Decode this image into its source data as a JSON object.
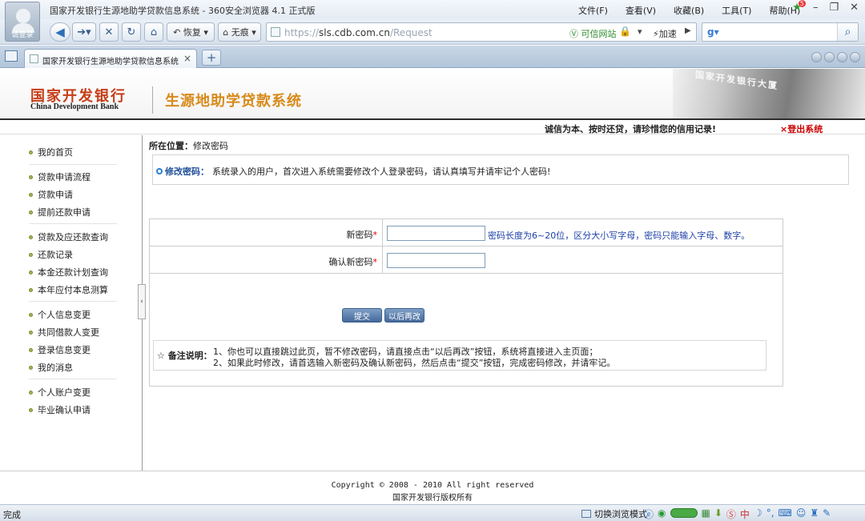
{
  "browser": {
    "avatar_label": "请登录",
    "window_title": "国家开发银行生源地助学贷款信息系统 - 360安全浏览器 4.1 正式版",
    "menu": [
      "文件(F)",
      "查看(V)",
      "收藏(B)",
      "工具(T)",
      "帮助(H)"
    ],
    "notification_count": "5",
    "restore_label": "恢复",
    "noimage_label": "无痕",
    "url_scheme": "https://",
    "url_host": "sls.cdb.com.cn",
    "url_path": "/Request",
    "trust_label": "可信网站",
    "speed_label": "加速",
    "tab_title": "国家开发银行生源地助学贷款信息系统",
    "status_text": "完成",
    "mode_label": "切换浏览模式"
  },
  "header": {
    "bank_name_cn": "国家开发银行",
    "bank_name_en": "China Development Bank",
    "system_title": "生源地助学贷款系统",
    "building_sign": "国家开发银行大厦",
    "slogan": "诚信为本、按时还贷，请珍惜您的信用记录!",
    "logout": "×登出系统"
  },
  "sidebar": {
    "items": [
      "我的首页",
      "贷款申请流程",
      "贷款申请",
      "提前还款申请",
      "贷款及应还款查询",
      "还款记录",
      "本金还款计划查询",
      "本年应付本息测算",
      "个人信息变更",
      "共同借款人变更",
      "登录信息变更",
      "我的消息",
      "个人账户变更",
      "毕业确认申请"
    ],
    "collapse_glyph": "‹"
  },
  "main": {
    "breadcrumb_label": "所在位置：",
    "breadcrumb_value": "修改密码",
    "notice_title": "修改密码：",
    "notice_text": "系统录入的用户，首次进入系统需要修改个人登录密码，请认真填写并请牢记个人密码!",
    "new_password_label": "新密码",
    "confirm_password_label": "确认新密码",
    "required_mark": "*",
    "new_password_value": "",
    "confirm_password_value": "",
    "password_hint": "密码长度为6~20位，区分大小写字母，密码只能输入字母、数字。",
    "submit_label": "提交",
    "later_label": "以后再改",
    "remark_title": "☆ 备注说明：",
    "remark_line1": "1、你也可以直接跳过此页，暂不修改密码，请直接点击“以后再改”按钮，系统将直接进入主页面；",
    "remark_line2": "2、如果此时修改，请首选输入新密码及确认新密码，然后点击“提交”按钮，完成密码修改，并请牢记。"
  },
  "footer": {
    "copyright": "Copyright © 2008 - 2010 All right reserved",
    "owner": "国家开发银行版权所有"
  },
  "colors": {
    "brand_red": "#c63d17",
    "title_orange": "#d88a1a",
    "hint_blue": "#1d3fa8",
    "button_blue": "#45699a"
  }
}
